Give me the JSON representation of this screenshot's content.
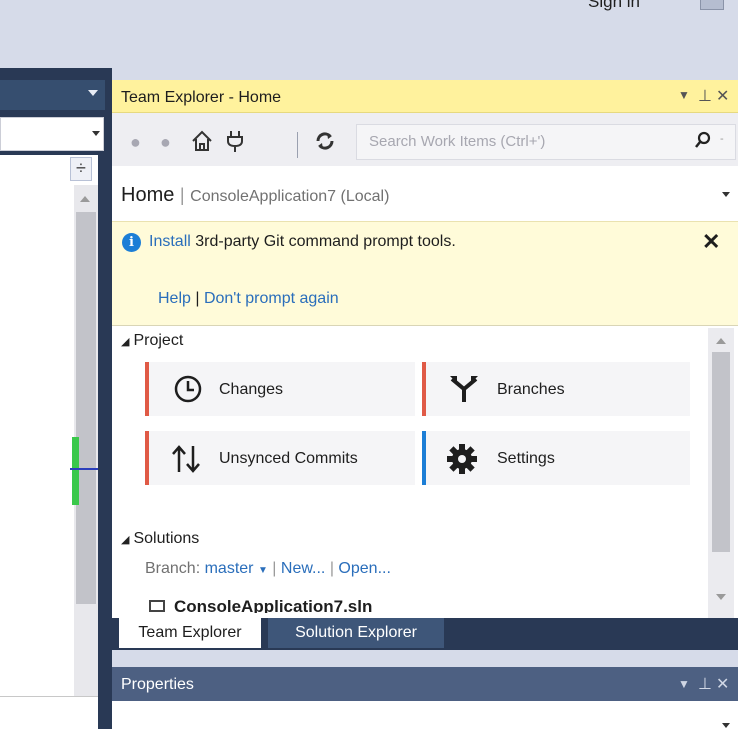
{
  "top": {
    "signin_label": "Sign in"
  },
  "team_explorer": {
    "title": "Team Explorer - Home",
    "window_buttons": {
      "dropdown": "▾",
      "pin": "Ⅲ",
      "close": "✕"
    },
    "toolbar": {
      "back_icon": "back-icon",
      "forward_icon": "forward-icon",
      "home_icon": "home-icon",
      "connect_icon": "plug-icon",
      "refresh_icon": "refresh-icon",
      "search_placeholder": "Search Work Items (Ctrl+')"
    },
    "header": {
      "title": "Home",
      "separator": "|",
      "subtitle": "ConsoleApplication7 (Local)"
    },
    "infobar": {
      "link": "Install",
      "text": " 3rd-party Git command prompt tools.",
      "help": "Help",
      "sep": " | ",
      "dont_prompt": "Don't prompt again"
    },
    "project": {
      "header": "Project",
      "tiles": [
        {
          "label": "Changes",
          "icon": "clock-icon",
          "bar": "#e05a46"
        },
        {
          "label": "Branches",
          "icon": "branch-icon",
          "bar": "#e05a46"
        },
        {
          "label": "Unsynced Commits",
          "icon": "sync-arrows-icon",
          "bar": "#e05a46"
        },
        {
          "label": "Settings",
          "icon": "gear-icon",
          "bar": "#1c7ed6"
        }
      ]
    },
    "solutions": {
      "header": "Solutions",
      "branch_label": "Branch:",
      "branch_value": "master",
      "new_label": "New...",
      "open_label": "Open...",
      "solution_name": "ConsoleApplication7.sln"
    }
  },
  "tabs": [
    "Team Explorer",
    "Solution Explorer"
  ],
  "properties": {
    "title": "Properties"
  }
}
